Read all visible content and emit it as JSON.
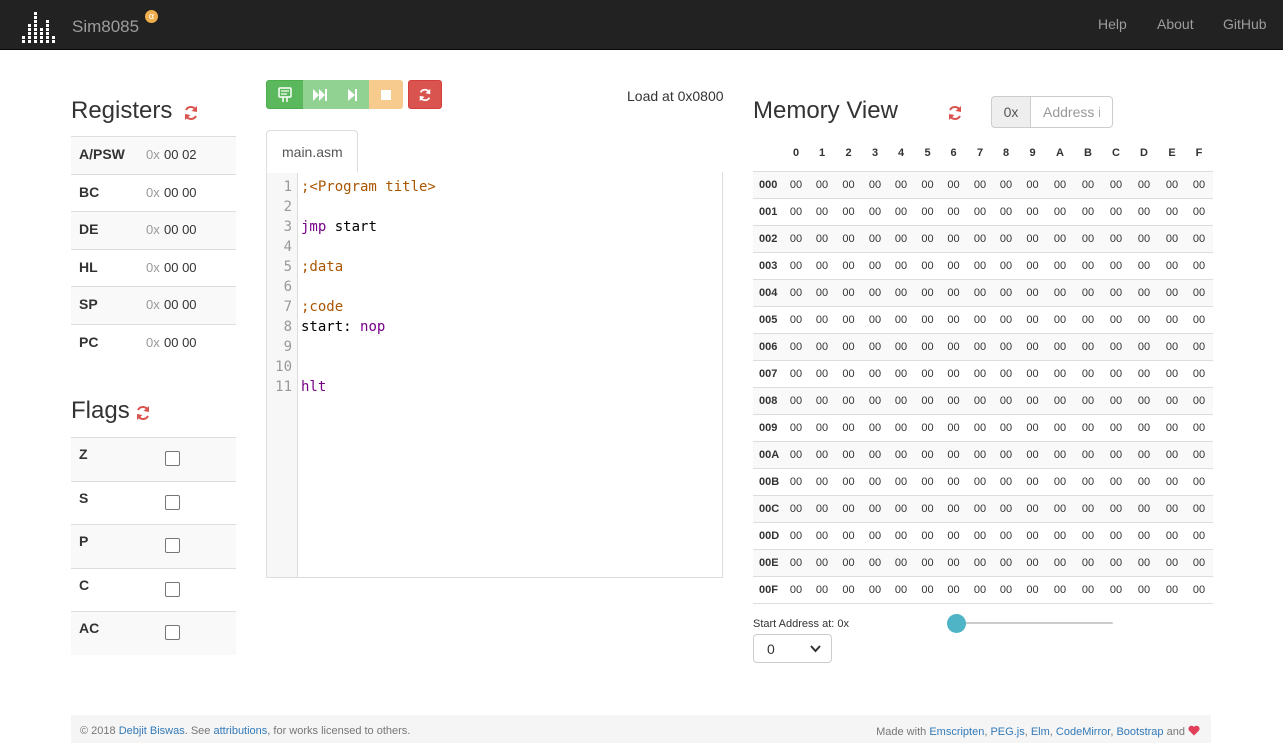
{
  "navbar": {
    "brand": "Sim8085",
    "badge": "α",
    "links": [
      "Help",
      "About",
      "GitHub"
    ]
  },
  "registers": {
    "title": "Registers",
    "prefix": "0x",
    "rows": [
      {
        "name": "A/PSW",
        "value": "00 02"
      },
      {
        "name": "BC",
        "value": "00 00"
      },
      {
        "name": "DE",
        "value": "00 00"
      },
      {
        "name": "HL",
        "value": "00 00"
      },
      {
        "name": "SP",
        "value": "00 00"
      },
      {
        "name": "PC",
        "value": "00 00"
      }
    ]
  },
  "flags": {
    "title": "Flags",
    "rows": [
      {
        "name": "Z",
        "checked": false
      },
      {
        "name": "S",
        "checked": false
      },
      {
        "name": "P",
        "checked": false
      },
      {
        "name": "C",
        "checked": false
      },
      {
        "name": "AC",
        "checked": false
      }
    ]
  },
  "toolbar": {
    "buttons": [
      {
        "name": "assemble-button",
        "icon": "assemble-icon",
        "color": "#5cb85c"
      },
      {
        "name": "run-button",
        "icon": "fast-forward-icon",
        "color": "#91d191"
      },
      {
        "name": "step-button",
        "icon": "step-forward-icon",
        "color": "#91d191"
      },
      {
        "name": "stop-button",
        "icon": "stop-icon",
        "color": "#f7cb8d"
      },
      {
        "name": "reset-button",
        "icon": "refresh-icon",
        "color": "#d9534f"
      }
    ],
    "load_at": "Load at 0x0800"
  },
  "editor": {
    "tab": "main.asm",
    "lines": [
      {
        "n": "1",
        "tokens": [
          {
            "t": ";<Program title>",
            "c": "comment"
          }
        ]
      },
      {
        "n": "2",
        "tokens": []
      },
      {
        "n": "3",
        "tokens": [
          {
            "t": "jmp",
            "c": "kw"
          },
          {
            "t": " start",
            "c": ""
          }
        ]
      },
      {
        "n": "4",
        "tokens": []
      },
      {
        "n": "5",
        "tokens": [
          {
            "t": ";data",
            "c": "comment"
          }
        ]
      },
      {
        "n": "6",
        "tokens": []
      },
      {
        "n": "7",
        "tokens": [
          {
            "t": ";code",
            "c": "comment"
          }
        ]
      },
      {
        "n": "8",
        "tokens": [
          {
            "t": "start: ",
            "c": ""
          },
          {
            "t": "nop",
            "c": "kw"
          }
        ]
      },
      {
        "n": "9",
        "tokens": []
      },
      {
        "n": "10",
        "tokens": []
      },
      {
        "n": "11",
        "tokens": [
          {
            "t": "hlt",
            "c": "kw"
          }
        ]
      }
    ]
  },
  "memory": {
    "title": "Memory View",
    "prefix": "0x",
    "placeholder": "Address in hex",
    "columns": [
      "0",
      "1",
      "2",
      "3",
      "4",
      "5",
      "6",
      "7",
      "8",
      "9",
      "A",
      "B",
      "C",
      "D",
      "E",
      "F"
    ],
    "rows": [
      "000",
      "001",
      "002",
      "003",
      "004",
      "005",
      "006",
      "007",
      "008",
      "009",
      "00A",
      "00B",
      "00C",
      "00D",
      "00E",
      "00F"
    ],
    "cell_value": "00",
    "start_label": "Start Address at: 0x",
    "start_value": "0",
    "slider_value": 0
  },
  "footer": {
    "copyright": "© 2018 ",
    "author": "Debjit Biswas",
    "see": ". See ",
    "attributions": "attributions",
    "rest": ", for works licensed to others.",
    "made_with": "Made with ",
    "techs": [
      "Emscripten",
      "PEG.js",
      "Elm",
      "CodeMirror",
      "Bootstrap"
    ],
    "and": " and "
  }
}
